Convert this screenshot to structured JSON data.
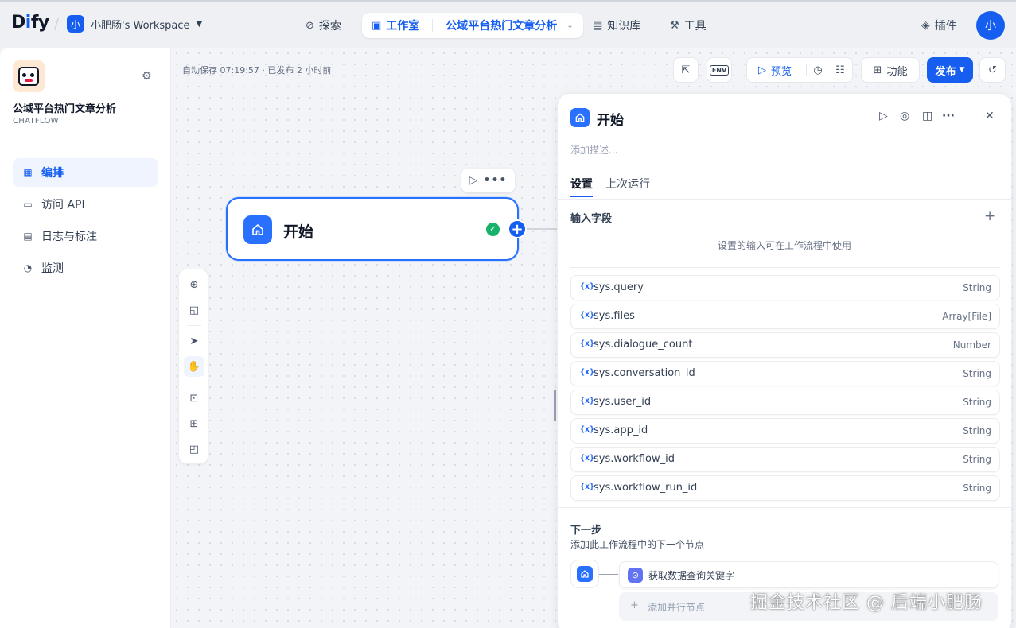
{
  "brand": {
    "logo_prefix": "D",
    "logo_i": "i",
    "logo_suffix": "fy"
  },
  "workspace": {
    "avatar": "小",
    "name": "小肥肠's Workspace"
  },
  "nav": {
    "explore": "探索",
    "studio": "工作室",
    "current_app": "公域平台热门文章分析",
    "knowledge": "知识库",
    "tools": "工具",
    "plugins": "插件",
    "user_avatar": "小"
  },
  "sidebar": {
    "app_name": "公域平台热门文章分析",
    "app_type": "CHATFLOW",
    "items": [
      {
        "label": "编排",
        "icon": "layout-icon",
        "active": true
      },
      {
        "label": "访问 API",
        "icon": "terminal-icon",
        "active": false
      },
      {
        "label": "日志与标注",
        "icon": "file-list-icon",
        "active": false
      },
      {
        "label": "监测",
        "icon": "dashboard-icon",
        "active": false
      }
    ]
  },
  "canvas": {
    "autosave": "自动保存 07:19:57 · 已发布 2 小时前",
    "toolbar": {
      "env_label": "ENV",
      "preview": "预览",
      "features": "功能",
      "publish": "发布"
    },
    "start_node": {
      "title": "开始"
    }
  },
  "panel": {
    "title": "开始",
    "description_placeholder": "添加描述...",
    "tabs": [
      "设置",
      "上次运行"
    ],
    "input_section_title": "输入字段",
    "input_hint": "设置的输入可在工作流程中使用",
    "var_icon": "{x}",
    "variables": [
      {
        "name": "sys.query",
        "type": "String"
      },
      {
        "name": "sys.files",
        "type": "Array[File]"
      },
      {
        "name": "sys.dialogue_count",
        "type": "Number"
      },
      {
        "name": "sys.conversation_id",
        "type": "String"
      },
      {
        "name": "sys.user_id",
        "type": "String"
      },
      {
        "name": "sys.app_id",
        "type": "String"
      },
      {
        "name": "sys.workflow_id",
        "type": "String"
      },
      {
        "name": "sys.workflow_run_id",
        "type": "String"
      }
    ],
    "next_title": "下一步",
    "next_desc": "添加此工作流程中的下一个节点",
    "next_node": "获取数据查询关键字",
    "add_parallel": "添加并行节点"
  },
  "watermark": "掘金技术社区 @ 后端小肥肠",
  "colors": {
    "accent": "#155eef",
    "node_icon": "#2970ff",
    "success": "#17b26a"
  }
}
